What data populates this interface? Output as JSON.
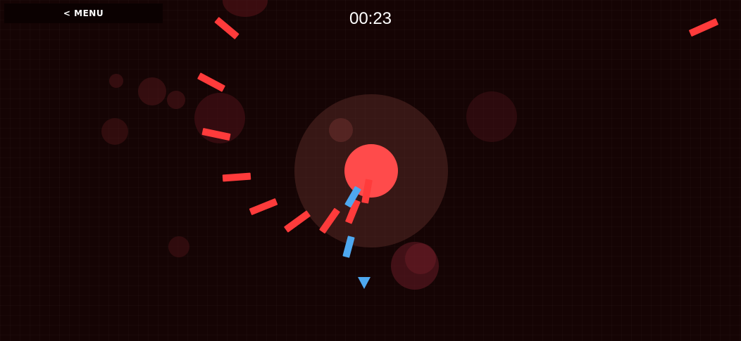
{
  "menu": {
    "label": "< MENU"
  },
  "hud": {
    "timer": "00:23"
  },
  "colors": {
    "background": "#150404",
    "enemy_bar": "#ff3b3b",
    "player_bar": "#4ea8f0",
    "core": "#ff4b4b"
  },
  "icons": {
    "direction_indicator": "triangle-down-icon"
  }
}
